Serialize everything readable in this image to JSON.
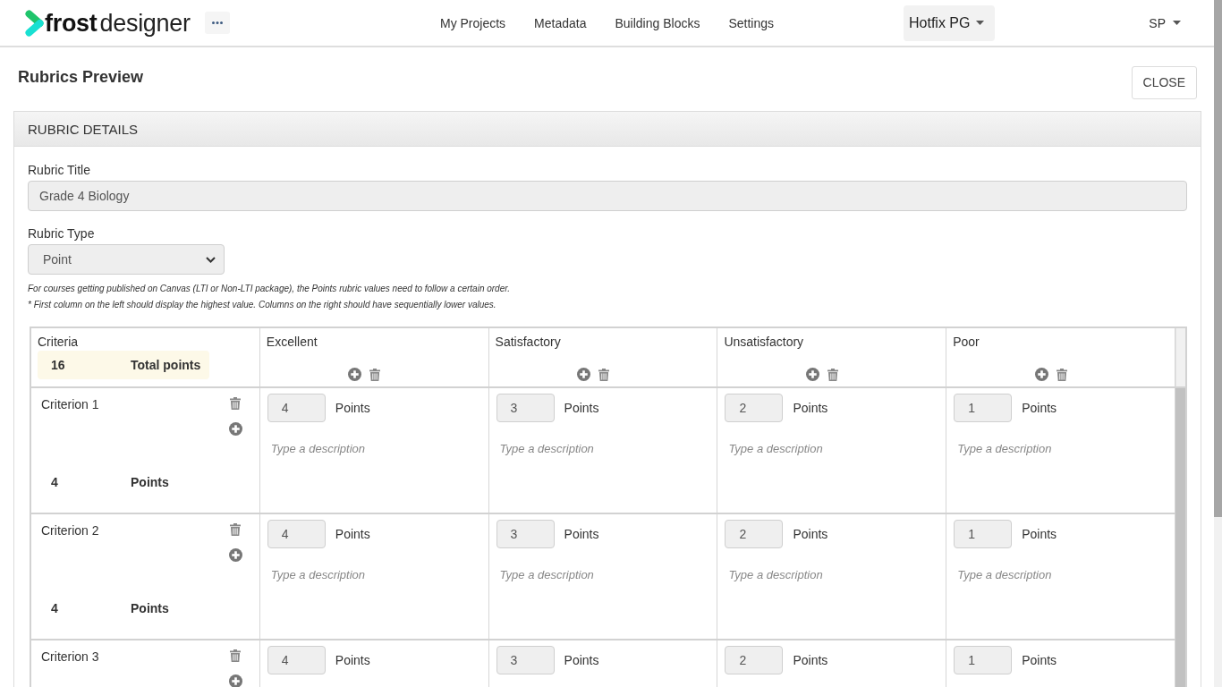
{
  "header": {
    "logo": "**frost**designer",
    "nav": [
      {
        "label": "My Projects"
      },
      {
        "label": "Metadata"
      },
      {
        "label": "Building Blocks"
      },
      {
        "label": "Settings"
      }
    ],
    "workspace": "Hotfix PG",
    "user": "SP"
  },
  "page": {
    "title": "Rubrics Preview",
    "close_button": "CLOSE"
  },
  "panel": {
    "title": "RUBRIC DETAILS",
    "rubric_title": {
      "label": "Rubric Title",
      "value": "Grade 4 Biology"
    },
    "rubric_type": {
      "label": "Rubric Type",
      "value": "Point"
    },
    "notes": [
      "For courses getting published on Canvas (LTI or Non-LTI package), the Points rubric values need to follow a certain order.",
      "* First column on the left should display the highest value. Columns on the right should have sequentially lower values."
    ],
    "table": {
      "criteria_header": "Criteria",
      "total": {
        "value": "16",
        "label": "Total points"
      },
      "columns": [
        {
          "label": "Excellent"
        },
        {
          "label": "Satisfactory"
        },
        {
          "label": "Unsatisfactory"
        },
        {
          "label": "Poor"
        }
      ],
      "rows": [
        {
          "name": "Criterion 1",
          "points": {
            "value": "4",
            "label": "Points"
          },
          "cells": [
            {
              "value": "4",
              "unit": "Points",
              "placeholder": "Type a description"
            },
            {
              "value": "3",
              "unit": "Points",
              "placeholder": "Type a description"
            },
            {
              "value": "2",
              "unit": "Points",
              "placeholder": "Type a description"
            },
            {
              "value": "1",
              "unit": "Points",
              "placeholder": "Type a description"
            }
          ]
        },
        {
          "name": "Criterion 2",
          "points": {
            "value": "4",
            "label": "Points"
          },
          "cells": [
            {
              "value": "4",
              "unit": "Points",
              "placeholder": "Type a description"
            },
            {
              "value": "3",
              "unit": "Points",
              "placeholder": "Type a description"
            },
            {
              "value": "2",
              "unit": "Points",
              "placeholder": "Type a description"
            },
            {
              "value": "1",
              "unit": "Points",
              "placeholder": "Type a description"
            }
          ]
        },
        {
          "name": "Criterion 3",
          "cells": [
            {
              "value": "4",
              "unit": "Points"
            },
            {
              "value": "3",
              "unit": "Points"
            },
            {
              "value": "2",
              "unit": "Points"
            },
            {
              "value": "1",
              "unit": "Points"
            }
          ]
        }
      ]
    }
  }
}
